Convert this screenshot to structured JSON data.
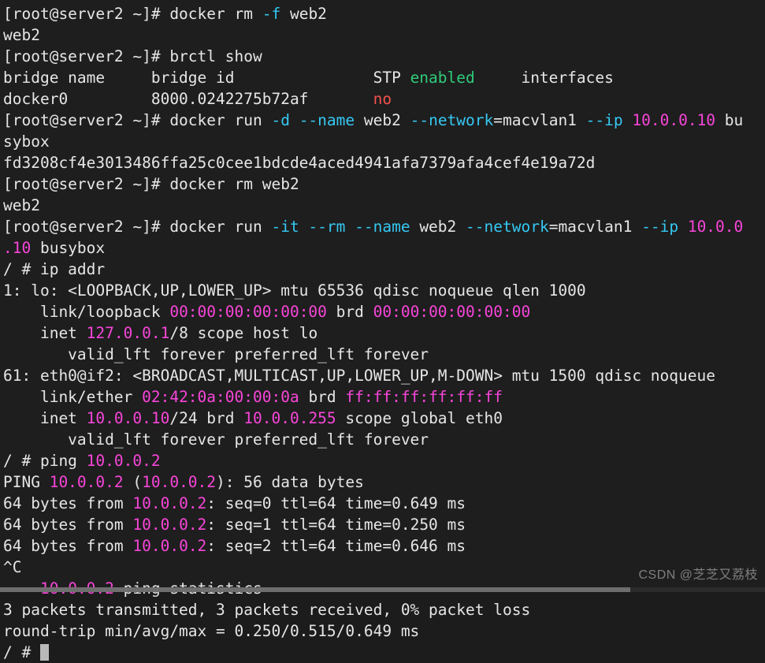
{
  "terminal": {
    "background_color": "#1e1e1e",
    "foreground_color": "#e6e6e6",
    "accent_colors": {
      "cyan": "#35c8f2",
      "green": "#2ecc7a",
      "red": "#f4524d",
      "magenta": "#f845d9",
      "cursor": "#b9b9b9"
    },
    "prompt_host": "[root@server2 ~]#",
    "prompt_container": "/ #",
    "cursor_visible": true,
    "lines": [
      {
        "id": "l1",
        "segments": [
          {
            "t": "[root@server2 ~]# docker rm ",
            "c": "w"
          },
          {
            "t": "-f",
            "c": "c"
          },
          {
            "t": " web2",
            "c": "w"
          }
        ]
      },
      {
        "id": "l2",
        "segments": [
          {
            "t": "web2",
            "c": "w"
          }
        ]
      },
      {
        "id": "l3",
        "segments": [
          {
            "t": "[root@server2 ~]# brctl show",
            "c": "w"
          }
        ]
      },
      {
        "id": "l4",
        "segments": [
          {
            "t": "bridge name\tbridge id\t\tSTP ",
            "c": "w"
          },
          {
            "t": "enabled",
            "c": "g"
          },
          {
            "t": "\tinterfaces",
            "c": "w"
          }
        ]
      },
      {
        "id": "l5",
        "segments": [
          {
            "t": "docker0\t\t8000.0242275b72af\t",
            "c": "w"
          },
          {
            "t": "no",
            "c": "r"
          }
        ]
      },
      {
        "id": "l6",
        "segments": [
          {
            "t": "[root@server2 ~]# docker run ",
            "c": "w"
          },
          {
            "t": "-d --name",
            "c": "c"
          },
          {
            "t": " web2 ",
            "c": "w"
          },
          {
            "t": "--network",
            "c": "c"
          },
          {
            "t": "=macvlan1 ",
            "c": "w"
          },
          {
            "t": "--ip",
            "c": "c"
          },
          {
            "t": " ",
            "c": "w"
          },
          {
            "t": "10.0.0.10",
            "c": "m"
          },
          {
            "t": " bu",
            "c": "w"
          }
        ]
      },
      {
        "id": "l7",
        "segments": [
          {
            "t": "sybox",
            "c": "w"
          }
        ]
      },
      {
        "id": "l8",
        "segments": [
          {
            "t": "fd3208cf4e3013486ffa25c0cee1bdcde4aced4941afa7379afa4cef4e19a72d",
            "c": "w"
          }
        ]
      },
      {
        "id": "l9",
        "segments": [
          {
            "t": "[root@server2 ~]# docker rm web2",
            "c": "w"
          }
        ]
      },
      {
        "id": "l10",
        "segments": [
          {
            "t": "web2",
            "c": "w"
          }
        ]
      },
      {
        "id": "l11",
        "segments": [
          {
            "t": "[root@server2 ~]# docker run ",
            "c": "w"
          },
          {
            "t": "-it --rm --name",
            "c": "c"
          },
          {
            "t": " web2 ",
            "c": "w"
          },
          {
            "t": "--network",
            "c": "c"
          },
          {
            "t": "=macvlan1 ",
            "c": "w"
          },
          {
            "t": "--ip",
            "c": "c"
          },
          {
            "t": " ",
            "c": "w"
          },
          {
            "t": "10.0.0",
            "c": "m"
          }
        ]
      },
      {
        "id": "l12",
        "segments": [
          {
            "t": ".10",
            "c": "m"
          },
          {
            "t": " busybox",
            "c": "w"
          }
        ]
      },
      {
        "id": "l13",
        "segments": [
          {
            "t": "/ # ip addr",
            "c": "w"
          }
        ]
      },
      {
        "id": "l14",
        "segments": [
          {
            "t": "1: lo: <LOOPBACK,UP,LOWER_UP> mtu 65536 qdisc noqueue qlen 1000",
            "c": "w"
          }
        ]
      },
      {
        "id": "l15",
        "segments": [
          {
            "t": "    link/loopback ",
            "c": "w"
          },
          {
            "t": "00:00:00:00:00:00",
            "c": "m"
          },
          {
            "t": " brd ",
            "c": "w"
          },
          {
            "t": "00:00:00:00:00:00",
            "c": "m"
          }
        ]
      },
      {
        "id": "l16",
        "segments": [
          {
            "t": "    inet ",
            "c": "w"
          },
          {
            "t": "127.0.0.1",
            "c": "m"
          },
          {
            "t": "/8 scope host lo",
            "c": "w"
          }
        ]
      },
      {
        "id": "l17",
        "segments": [
          {
            "t": "       valid_lft forever preferred_lft forever",
            "c": "w"
          }
        ]
      },
      {
        "id": "l18",
        "segments": [
          {
            "t": "61: eth0@if2: <BROADCAST,MULTICAST,UP,LOWER_UP,M-DOWN> mtu 1500 qdisc noqueue",
            "c": "w"
          }
        ]
      },
      {
        "id": "l19",
        "segments": [
          {
            "t": "    link/ether ",
            "c": "w"
          },
          {
            "t": "02:42:0a:00:00:0a",
            "c": "m"
          },
          {
            "t": " brd ",
            "c": "w"
          },
          {
            "t": "ff:ff:ff:ff:ff:ff",
            "c": "m"
          }
        ]
      },
      {
        "id": "l20",
        "segments": [
          {
            "t": "    inet ",
            "c": "w"
          },
          {
            "t": "10.0.0.10",
            "c": "m"
          },
          {
            "t": "/24 brd ",
            "c": "w"
          },
          {
            "t": "10.0.0.255",
            "c": "m"
          },
          {
            "t": " scope global eth0",
            "c": "w"
          }
        ]
      },
      {
        "id": "l21",
        "segments": [
          {
            "t": "       valid_lft forever preferred_lft forever",
            "c": "w"
          }
        ]
      },
      {
        "id": "l22",
        "segments": [
          {
            "t": "/ # ping ",
            "c": "w"
          },
          {
            "t": "10.0.0.2",
            "c": "m"
          }
        ]
      },
      {
        "id": "l23",
        "segments": [
          {
            "t": "PING ",
            "c": "w"
          },
          {
            "t": "10.0.0.2",
            "c": "m"
          },
          {
            "t": " (",
            "c": "w"
          },
          {
            "t": "10.0.0.2",
            "c": "m"
          },
          {
            "t": "): 56 data bytes",
            "c": "w"
          }
        ]
      },
      {
        "id": "l24",
        "segments": [
          {
            "t": "64 bytes from ",
            "c": "w"
          },
          {
            "t": "10.0.0.2",
            "c": "m"
          },
          {
            "t": ": seq=0 ttl=64 time=0.649 ms",
            "c": "w"
          }
        ]
      },
      {
        "id": "l25",
        "segments": [
          {
            "t": "64 bytes from ",
            "c": "w"
          },
          {
            "t": "10.0.0.2",
            "c": "m"
          },
          {
            "t": ": seq=1 ttl=64 time=0.250 ms",
            "c": "w"
          }
        ]
      },
      {
        "id": "l26",
        "segments": [
          {
            "t": "64 bytes from ",
            "c": "w"
          },
          {
            "t": "10.0.0.2",
            "c": "m"
          },
          {
            "t": ": seq=2 ttl=64 time=0.646 ms",
            "c": "w"
          }
        ]
      },
      {
        "id": "l27",
        "segments": [
          {
            "t": "^C",
            "c": "w"
          }
        ]
      },
      {
        "id": "l28",
        "segments": [
          {
            "t": "---",
            "c": "c"
          },
          {
            "t": " ",
            "c": "w"
          },
          {
            "t": "10.0.0.2",
            "c": "m"
          },
          {
            "t": " ping statistics ",
            "c": "w"
          },
          {
            "t": "---",
            "c": "c"
          }
        ]
      },
      {
        "id": "l29",
        "segments": [
          {
            "t": "3 packets transmitted, 3 packets received, 0% packet loss",
            "c": "w"
          }
        ]
      },
      {
        "id": "l30",
        "segments": [
          {
            "t": "round-trip min/avg/max = 0.250/0.515/0.649 ms",
            "c": "w"
          }
        ]
      },
      {
        "id": "l31",
        "segments": [
          {
            "t": "/ # ",
            "c": "w"
          }
        ],
        "cursor": true
      }
    ]
  },
  "watermark": {
    "text": "CSDN @芝芝又荔枝"
  }
}
